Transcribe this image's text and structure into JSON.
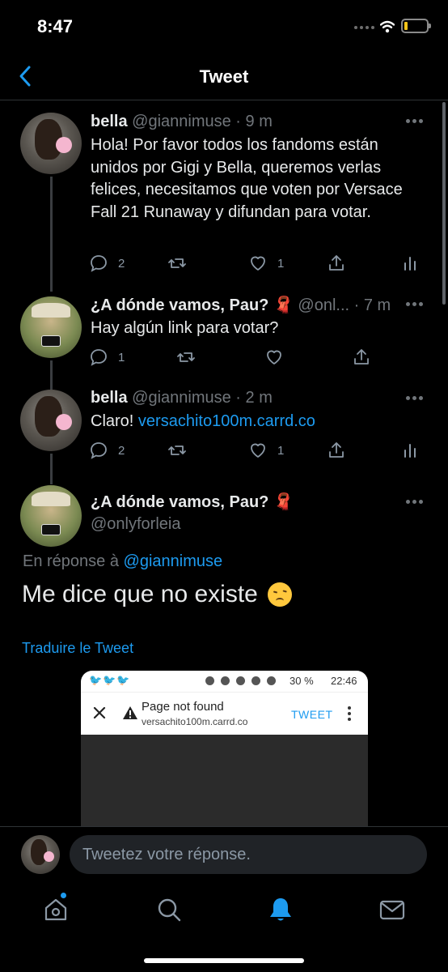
{
  "status_bar": {
    "time": "8:47"
  },
  "header": {
    "title": "Tweet"
  },
  "tweets": [
    {
      "display_name": "bella",
      "handle": "@giannimuse",
      "time": "· 9 m",
      "text": "Hola! Por favor todos los fandoms están unidos por Gigi y Bella, queremos verlas felices, necesitamos que voten por Versace Fall 21 Runaway y difundan para votar.",
      "replies": "2",
      "retweets": "",
      "likes": "1"
    },
    {
      "display_name": "¿A dónde vamos, Pau? 🧣",
      "handle": "@onl...",
      "time": "· 7 m",
      "text": "Hay algún link para votar?",
      "replies": "1",
      "retweets": "",
      "likes": ""
    },
    {
      "display_name": "bella",
      "handle": "@giannimuse",
      "time": "· 2 m",
      "text_prefix": "Claro!",
      "link": "versachito100m.carrd.co",
      "replies": "2",
      "retweets": "",
      "likes": "1"
    }
  ],
  "main_tweet": {
    "display_name": "¿A dónde vamos, Pau? 🧣",
    "handle": "@onlyforleia",
    "replying_prefix": "En réponse à",
    "replying_to": "@giannimuse",
    "text": "Me dice que no existe",
    "emoji": "disappointed-face",
    "translate_label": "Traduire le Tweet",
    "media": {
      "status_icons": "🐦🐦🐦",
      "battery": "30 %",
      "time": "22:46",
      "page_title": "Page not found",
      "page_url": "versachito100m.carrd.co",
      "tweet_button": "TWEET"
    }
  },
  "reply_bar": {
    "placeholder": "Tweetez votre réponse."
  },
  "tab_bar": {
    "active": "notifications",
    "accent": "#1d9bf0"
  },
  "colors": {
    "background": "#000000",
    "link": "#1d9bf0",
    "muted": "#71767b",
    "battery": "#f5c518"
  }
}
